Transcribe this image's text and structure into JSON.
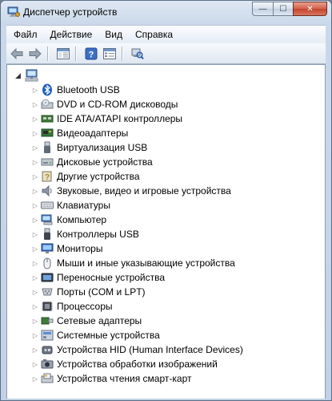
{
  "window": {
    "title": "Диспетчер устройств",
    "close_glyph": "✕",
    "minimize_glyph": "—",
    "maximize_glyph": "☐"
  },
  "menu": [
    "Файл",
    "Действие",
    "Вид",
    "Справка"
  ],
  "toolbar": {
    "buttons": [
      "back-icon",
      "forward-icon",
      "console-tree-icon",
      "help-icon",
      "properties-icon",
      "scan-hardware-icon"
    ]
  },
  "tree": {
    "root_icon": "computer-icon",
    "items": [
      {
        "label": "Bluetooth USB",
        "icon": "bluetooth-icon"
      },
      {
        "label": "DVD и CD-ROM дисководы",
        "icon": "dvd-drive-icon"
      },
      {
        "label": "IDE ATA/ATAPI контроллеры",
        "icon": "ide-controller-icon"
      },
      {
        "label": "Видеоадаптеры",
        "icon": "display-adapter-icon"
      },
      {
        "label": "Виртуализация USB",
        "icon": "usb-virtualization-icon"
      },
      {
        "label": "Дисковые устройства",
        "icon": "disk-drive-icon"
      },
      {
        "label": "Другие устройства",
        "icon": "other-devices-icon"
      },
      {
        "label": "Звуковые, видео и игровые устройства",
        "icon": "sound-icon"
      },
      {
        "label": "Клавиатуры",
        "icon": "keyboard-icon"
      },
      {
        "label": "Компьютер",
        "icon": "computer-icon"
      },
      {
        "label": "Контроллеры USB",
        "icon": "usb-controller-icon"
      },
      {
        "label": "Мониторы",
        "icon": "monitor-icon"
      },
      {
        "label": "Мыши и иные указывающие устройства",
        "icon": "mouse-icon"
      },
      {
        "label": "Переносные устройства",
        "icon": "portable-device-icon"
      },
      {
        "label": "Порты (COM и LPT)",
        "icon": "port-icon"
      },
      {
        "label": "Процессоры",
        "icon": "processor-icon"
      },
      {
        "label": "Сетевые адаптеры",
        "icon": "network-adapter-icon"
      },
      {
        "label": "Системные устройства",
        "icon": "system-devices-icon"
      },
      {
        "label": "Устройства HID (Human Interface Devices)",
        "icon": "hid-icon"
      },
      {
        "label": "Устройства обработки изображений",
        "icon": "imaging-device-icon"
      },
      {
        "label": "Устройства чтения смарт-карт",
        "icon": "smart-card-reader-icon"
      }
    ]
  },
  "colors": {
    "title_bar": "#c9d8ea",
    "close_button": "#c2432c",
    "content_bg": "#ffffff"
  }
}
